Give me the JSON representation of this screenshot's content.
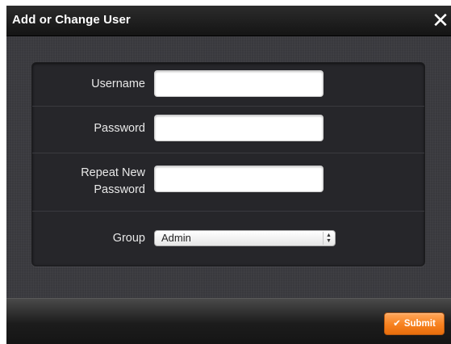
{
  "dialog": {
    "title": "Add or Change User",
    "close_icon": "close-icon",
    "close_glyph": "✕"
  },
  "form": {
    "username": {
      "label": "Username",
      "value": ""
    },
    "password": {
      "label": "Password",
      "value": ""
    },
    "repeat_password": {
      "label_line1": "Repeat New",
      "label_line2": "Password",
      "value": ""
    },
    "group": {
      "label": "Group",
      "selected": "Admin",
      "icon": "select-arrows-icon"
    }
  },
  "footer": {
    "submit_label": "Submit",
    "submit_icon": "check-icon",
    "check_glyph": "✔"
  },
  "colors": {
    "titlebar": "#1e1e1e",
    "background": "#3b3b40",
    "panel": "#26262a",
    "accent": "#f7811f"
  }
}
